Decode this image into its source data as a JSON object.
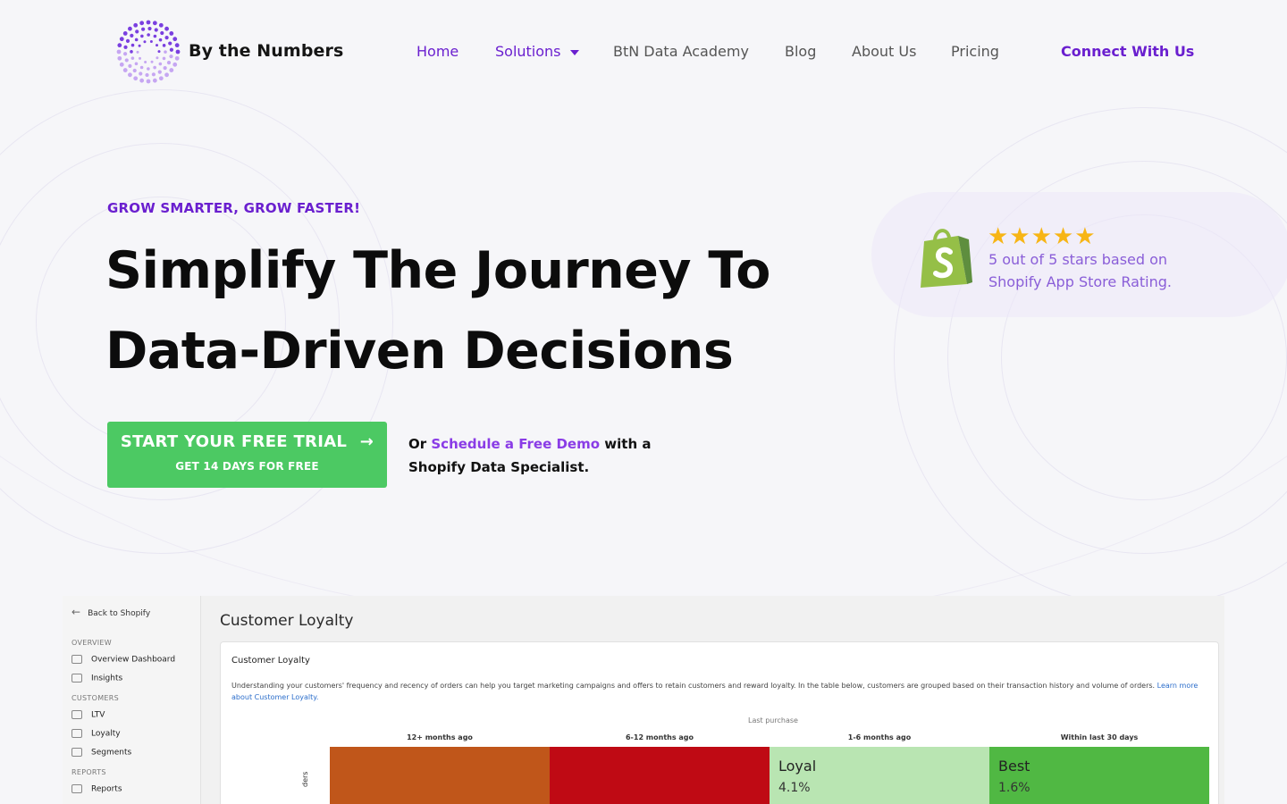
{
  "header": {
    "brand": "By the Numbers",
    "nav": [
      {
        "label": "Home",
        "active": true
      },
      {
        "label": "Solutions",
        "active": true,
        "has_dropdown": true
      },
      {
        "label": "BtN Data Academy"
      },
      {
        "label": "Blog"
      },
      {
        "label": "About Us"
      },
      {
        "label": "Pricing"
      }
    ],
    "connect_label": "Connect With Us"
  },
  "hero": {
    "eyebrow": "GROW SMARTER, GROW FASTER!",
    "headline_line1": "Simplify The Journey To",
    "headline_line2": "Data-Driven Decisions",
    "cta_main": "START YOUR FREE TRIAL",
    "cta_arrow": "→",
    "cta_sub": "GET 14 DAYS FOR FREE",
    "demo_prefix": "Or ",
    "demo_link": "Schedule a Free Demo",
    "demo_suffix": " with a Shopify Data Specialist."
  },
  "rating": {
    "stars": 5,
    "stars_glyphs": "★★★★★",
    "text": "5 out of 5 stars based on Shopify App Store Rating.",
    "icon": "shopify-bag-icon"
  },
  "preview": {
    "back_label": "Back to Shopify",
    "sections": {
      "overview": "OVERVIEW",
      "customers": "CUSTOMERS",
      "reports": "REPORTS"
    },
    "items": {
      "overview_dashboard": "Overview Dashboard",
      "insights": "Insights",
      "ltv": "LTV",
      "loyalty": "Loyalty",
      "segments": "Segments",
      "reports": "Reports"
    },
    "page_title": "Customer Loyalty",
    "card_title": "Customer Loyalty",
    "description": "Understanding your customers' frequency and recency of orders can help you target marketing campaigns and offers to retain customers and reward loyalty. In the table below, customers are grouped based on their transaction history and volume of orders. ",
    "learn_more": "Learn more about Customer Loyalty.",
    "last_purchase": "Last purchase",
    "y_label": "ders",
    "columns": [
      "12+ months ago",
      "6-12 months ago",
      "1-6 months ago",
      "Within last 30 days"
    ],
    "cells": [
      {
        "name": "",
        "pct": "",
        "color": "#c0561a"
      },
      {
        "name": "",
        "pct": "",
        "color": "#bf0a14"
      },
      {
        "name": "Loyal",
        "pct": "4.1%",
        "color": "#b9e5b2"
      },
      {
        "name": "Best",
        "pct": "1.6%",
        "color": "#50b843"
      }
    ]
  },
  "colors": {
    "accent": "#6a1fcf",
    "cta_green": "#4cc963",
    "star": "#f7b515",
    "rating_text": "#8a5ed8"
  }
}
